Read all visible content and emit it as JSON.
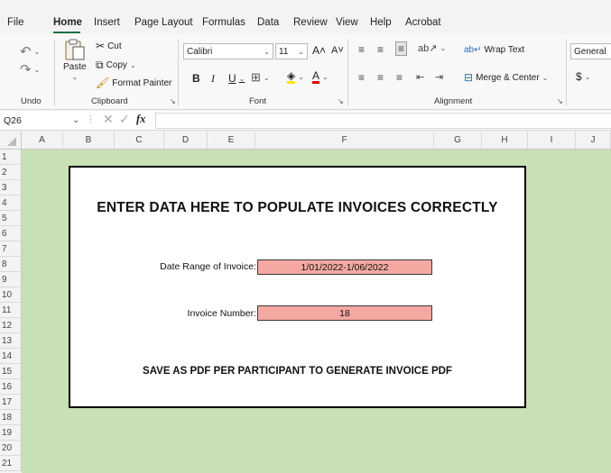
{
  "menu": {
    "tabs": [
      "File",
      "Home",
      "Insert",
      "Page Layout",
      "Formulas",
      "Data",
      "Review",
      "View",
      "Help",
      "Acrobat"
    ],
    "active": "Home"
  },
  "ribbon": {
    "undo": {
      "label": "Undo"
    },
    "clipboard": {
      "label": "Clipboard",
      "paste": "Paste",
      "cut": "Cut",
      "copy": "Copy",
      "format_painter": "Format Painter"
    },
    "font": {
      "label": "Font",
      "name": "Calibri",
      "size": "11",
      "bold": "B",
      "italic": "I",
      "underline": "U"
    },
    "alignment": {
      "label": "Alignment",
      "wrap_text": "Wrap Text",
      "merge_center": "Merge & Center"
    },
    "number": {
      "format": "General",
      "currency": "$"
    }
  },
  "formula_bar": {
    "cell_ref": "Q26",
    "fx": "fx",
    "value": ""
  },
  "columns": [
    "A",
    "B",
    "C",
    "D",
    "E",
    "F",
    "G",
    "H",
    "I",
    "J"
  ],
  "rows": [
    "1",
    "2",
    "3",
    "4",
    "5",
    "6",
    "7",
    "8",
    "9",
    "10",
    "11",
    "12",
    "13",
    "14",
    "15",
    "16",
    "17",
    "18",
    "19",
    "20",
    "21"
  ],
  "sheet": {
    "heading": "ENTER DATA HERE TO POPULATE INVOICES CORRECTLY",
    "date_range_label": "Date Range of Invoice:",
    "date_range_value": "1/01/2022-1/06/2022",
    "invoice_number_label": "Invoice Number:",
    "invoice_number_value": "18",
    "note": "SAVE AS PDF PER PARTICIPANT TO GENERATE INVOICE PDF"
  },
  "colors": {
    "sheet_bg": "#c7e0b4",
    "input_fill": "#f5a8a2",
    "accent": "#1e6f44"
  }
}
